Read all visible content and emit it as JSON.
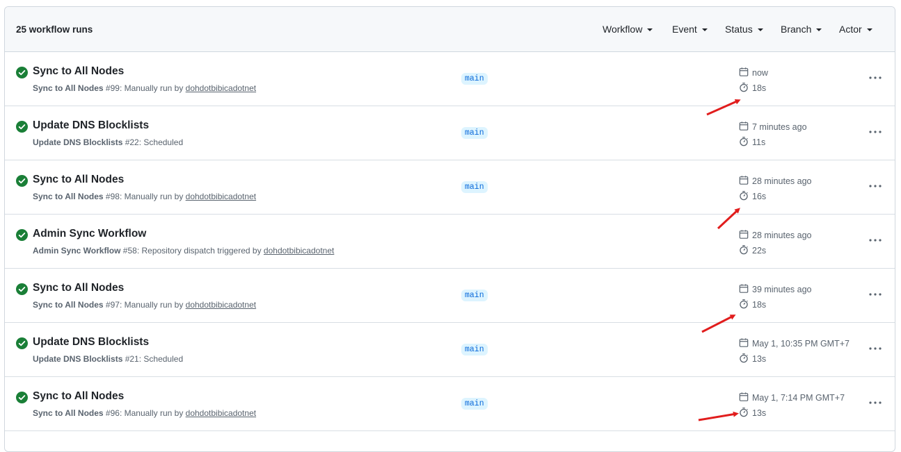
{
  "header": {
    "runs_count": "25 workflow runs",
    "filters": [
      "Workflow",
      "Event",
      "Status",
      "Branch",
      "Actor"
    ]
  },
  "runs": [
    {
      "title": "Sync to All Nodes",
      "workflow": "Sync to All Nodes",
      "number": " #99",
      "trigger": ": Manually run by ",
      "actor": "dohdotbibicadotnet",
      "branch": "main",
      "date": "now",
      "duration": "18s"
    },
    {
      "title": "Update DNS Blocklists",
      "workflow": "Update DNS Blocklists",
      "number": " #22",
      "trigger": ": Scheduled",
      "actor": "",
      "branch": "main",
      "date": "7 minutes ago",
      "duration": "11s"
    },
    {
      "title": "Sync to All Nodes",
      "workflow": "Sync to All Nodes",
      "number": " #98",
      "trigger": ": Manually run by ",
      "actor": "dohdotbibicadotnet",
      "branch": "main",
      "date": "28 minutes ago",
      "duration": "16s"
    },
    {
      "title": "Admin Sync Workflow",
      "workflow": "Admin Sync Workflow",
      "number": " #58",
      "trigger": ": Repository dispatch triggered by ",
      "actor": "dohdotbibicadotnet",
      "branch": "",
      "date": "28 minutes ago",
      "duration": "22s"
    },
    {
      "title": "Sync to All Nodes",
      "workflow": "Sync to All Nodes",
      "number": " #97",
      "trigger": ": Manually run by ",
      "actor": "dohdotbibicadotnet",
      "branch": "main",
      "date": "39 minutes ago",
      "duration": "18s"
    },
    {
      "title": "Update DNS Blocklists",
      "workflow": "Update DNS Blocklists",
      "number": " #21",
      "trigger": ": Scheduled",
      "actor": "",
      "branch": "main",
      "date": "May 1, 10:35 PM GMT+7",
      "duration": "13s"
    },
    {
      "title": "Sync to All Nodes",
      "workflow": "Sync to All Nodes",
      "number": " #96",
      "trigger": ": Manually run by ",
      "actor": "dohdotbibicadotnet",
      "branch": "main",
      "date": "May 1, 7:14 PM GMT+7",
      "duration": "13s"
    }
  ],
  "icons": {
    "status": "check-circle-fill-icon",
    "date": "calendar-icon",
    "duration": "stopwatch-icon",
    "menu": "kebab-horizontal-icon",
    "annotation": "red-arrow-annotation"
  },
  "colors": {
    "success": "#1a7f37",
    "branch_bg": "#ddf4ff",
    "branch_fg": "#0969da",
    "annotation": "#e11d1d"
  }
}
